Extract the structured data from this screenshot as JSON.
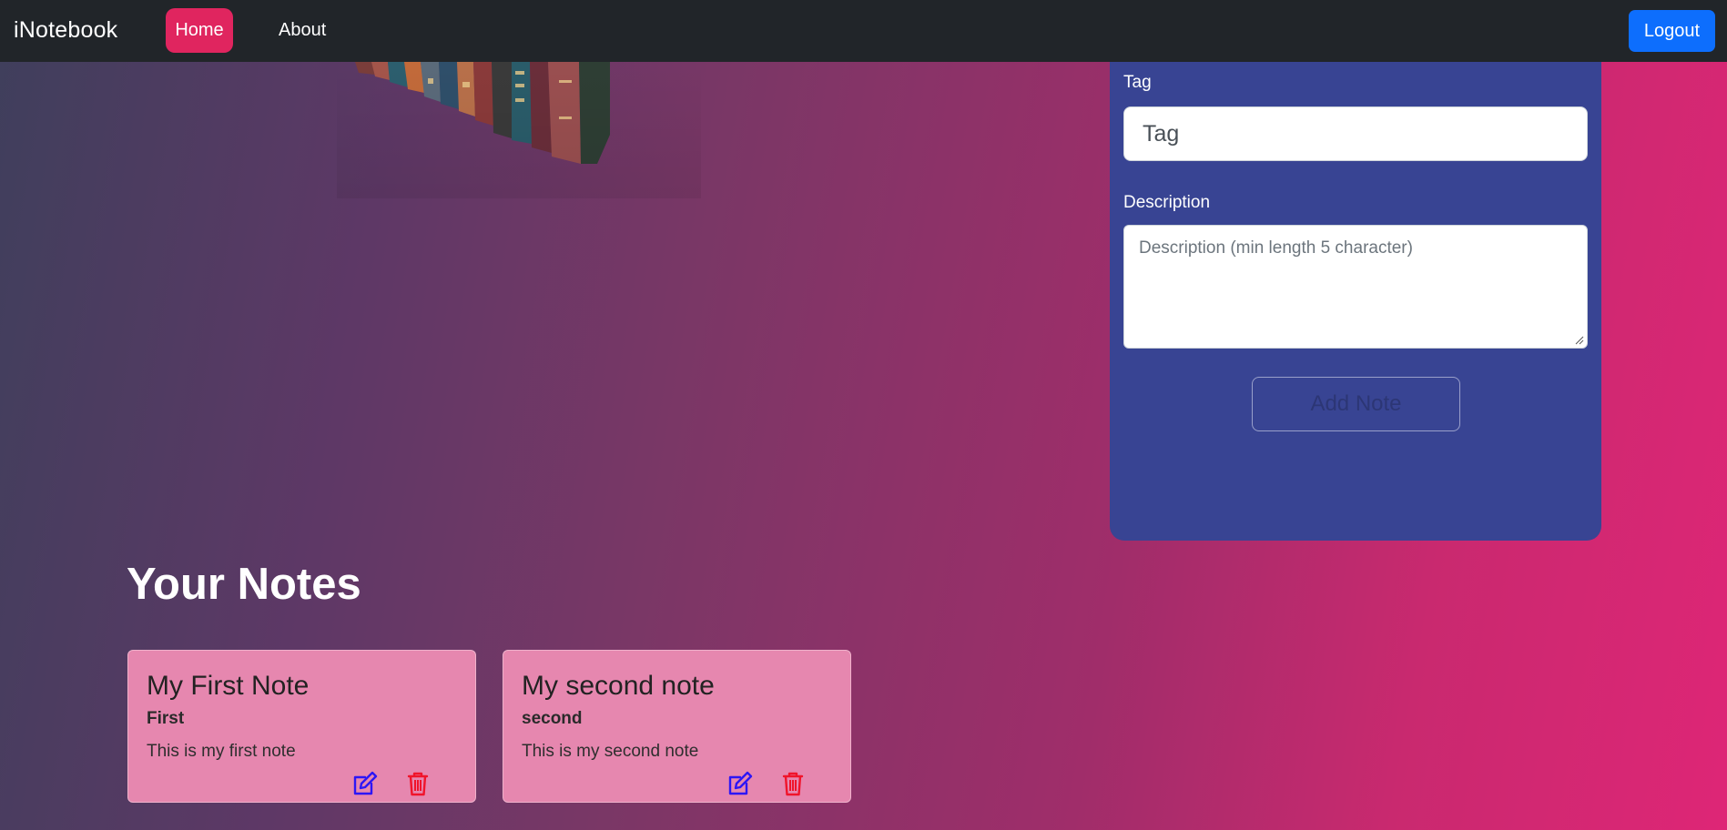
{
  "navbar": {
    "brand": "iNotebook",
    "links": [
      {
        "label": "Home",
        "active": true
      },
      {
        "label": "About",
        "active": false
      }
    ],
    "logout_label": "Logout"
  },
  "form": {
    "tag_label": "Tag",
    "tag_placeholder": "Tag",
    "description_label": "Description",
    "description_placeholder": "Description (min length 5 character)",
    "add_button_label": "Add Note"
  },
  "notes": {
    "heading": "Your Notes",
    "items": [
      {
        "title": "My First Note",
        "tag": "First",
        "description": "This is my first note"
      },
      {
        "title": "My second note",
        "tag": "second",
        "description": "This is my second note"
      }
    ]
  },
  "colors": {
    "navbar": "#212529",
    "home_active": "#e0255f",
    "logout": "#0d6efd",
    "panel": "#384493",
    "card": "#e687af",
    "edit_icon": "#2d16f5",
    "delete_icon": "#f0142b"
  },
  "icons": {
    "edit": "edit-icon",
    "delete": "trash-icon"
  }
}
